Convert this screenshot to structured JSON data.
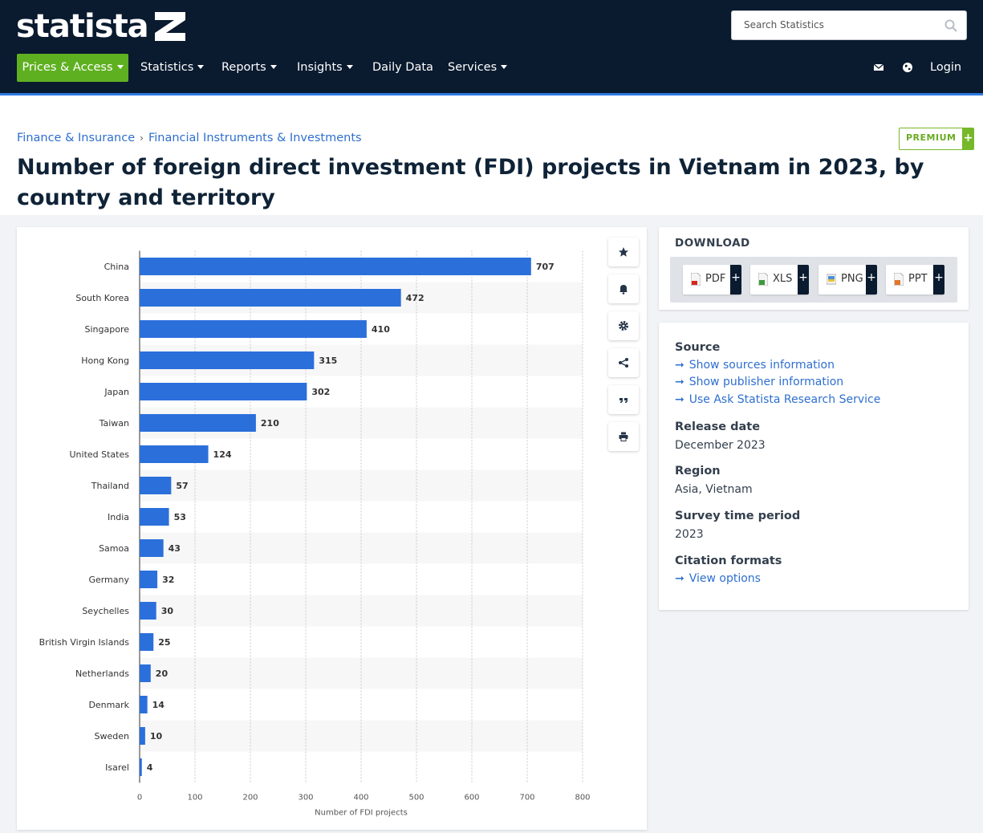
{
  "header": {
    "logo_text": "statista",
    "search": {
      "placeholder": "Search Statistics"
    },
    "nav": {
      "prices_access": "Prices & Access",
      "statistics": "Statistics",
      "reports": "Reports",
      "insights": "Insights",
      "daily_data": "Daily Data",
      "services": "Services",
      "login": "Login"
    },
    "brand_color": "#0a1a2f",
    "accent_green": "#5fb021"
  },
  "breadcrumb": {
    "items": [
      "Finance & Insurance",
      "Financial Instruments & Investments"
    ],
    "separator": "›"
  },
  "premium_badge": {
    "label": "PREMIUM",
    "plus": "+"
  },
  "page_title": "Number of foreign direct investment (FDI) projects in Vietnam in 2023, by country and territory",
  "chart_tools": [
    "star-icon",
    "bell-icon",
    "gear-icon",
    "share-icon",
    "quote-icon",
    "print-icon"
  ],
  "download": {
    "title": "DOWNLOAD",
    "buttons": [
      {
        "label": "PDF",
        "icon": "pdf-file-icon",
        "plus": "+"
      },
      {
        "label": "XLS",
        "icon": "xls-file-icon",
        "plus": "+"
      },
      {
        "label": "PNG",
        "icon": "png-file-icon",
        "plus": "+"
      },
      {
        "label": "PPT",
        "icon": "ppt-file-icon",
        "plus": "+"
      }
    ]
  },
  "info": {
    "source_heading": "Source",
    "source_links": [
      "Show sources information",
      "Show publisher information",
      "Use Ask Statista Research Service"
    ],
    "release_heading": "Release date",
    "release_value": "December 2023",
    "region_heading": "Region",
    "region_value": "Asia, Vietnam",
    "survey_heading": "Survey time period",
    "survey_value": "2023",
    "citation_heading": "Citation formats",
    "citation_link": "View options"
  },
  "chart_data": {
    "type": "bar",
    "orientation": "horizontal",
    "categories": [
      "China",
      "South Korea",
      "Singapore",
      "Hong Kong",
      "Japan",
      "Taiwan",
      "United States",
      "Thailand",
      "India",
      "Samoa",
      "Germany",
      "Seychelles",
      "British Virgin Islands",
      "Netherlands",
      "Denmark",
      "Sweden",
      "Isarel"
    ],
    "values": [
      707,
      472,
      410,
      315,
      302,
      210,
      124,
      57,
      53,
      43,
      32,
      30,
      25,
      20,
      14,
      10,
      4
    ],
    "xlabel": "Number of FDI projects",
    "ylabel": "",
    "xlim": [
      0,
      800
    ],
    "xticks": [
      0,
      100,
      200,
      300,
      400,
      500,
      600,
      700,
      800
    ],
    "bar_color": "#2b6fdb",
    "grid": true,
    "data_labels": true
  }
}
